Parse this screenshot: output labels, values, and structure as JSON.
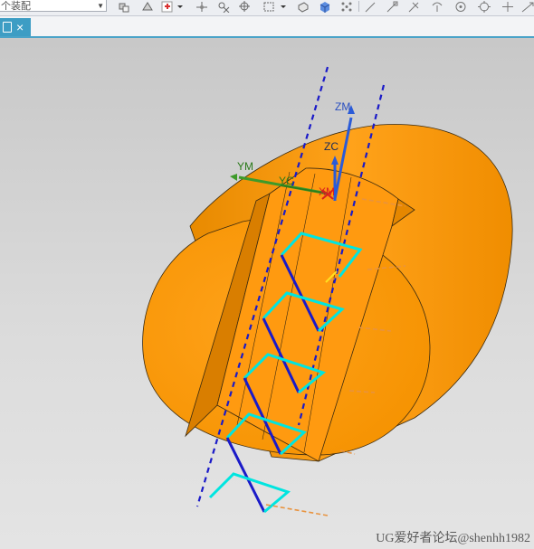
{
  "toolbar": {
    "filter_value": "个装配",
    "icons": [
      "assembly-constraints-icon",
      "show-hide-icon",
      "snap-icon",
      "dropdown-icon",
      "point-snap-icon",
      "intersection-icon",
      "box-select-icon",
      "dropdown-icon",
      "solid-icon",
      "cube-icon",
      "pattern-icon",
      "line-icon",
      "endpoint-icon",
      "tangent-icon",
      "perpendicular-icon",
      "center-icon",
      "quadrant-icon",
      "plus-icon",
      "angle-icon"
    ]
  },
  "tab": {
    "icon": "document-icon",
    "close": "×"
  },
  "axes": {
    "zm": "ZM",
    "zc": "ZC",
    "ym": "YM",
    "yc": "YC",
    "xm": "XM"
  },
  "colors": {
    "body": "#ff9900",
    "centerline": "#1a1ac8",
    "toolpath_cut": "#00e5e0",
    "toolpath_move": "#1a1ac8",
    "approach": "#e8933f",
    "zaxis": "#2a5bd8",
    "yaxis": "#3e9a2a",
    "xaxis": "#d82020"
  },
  "watermark": "UG爱好者论坛@shenhh1982"
}
